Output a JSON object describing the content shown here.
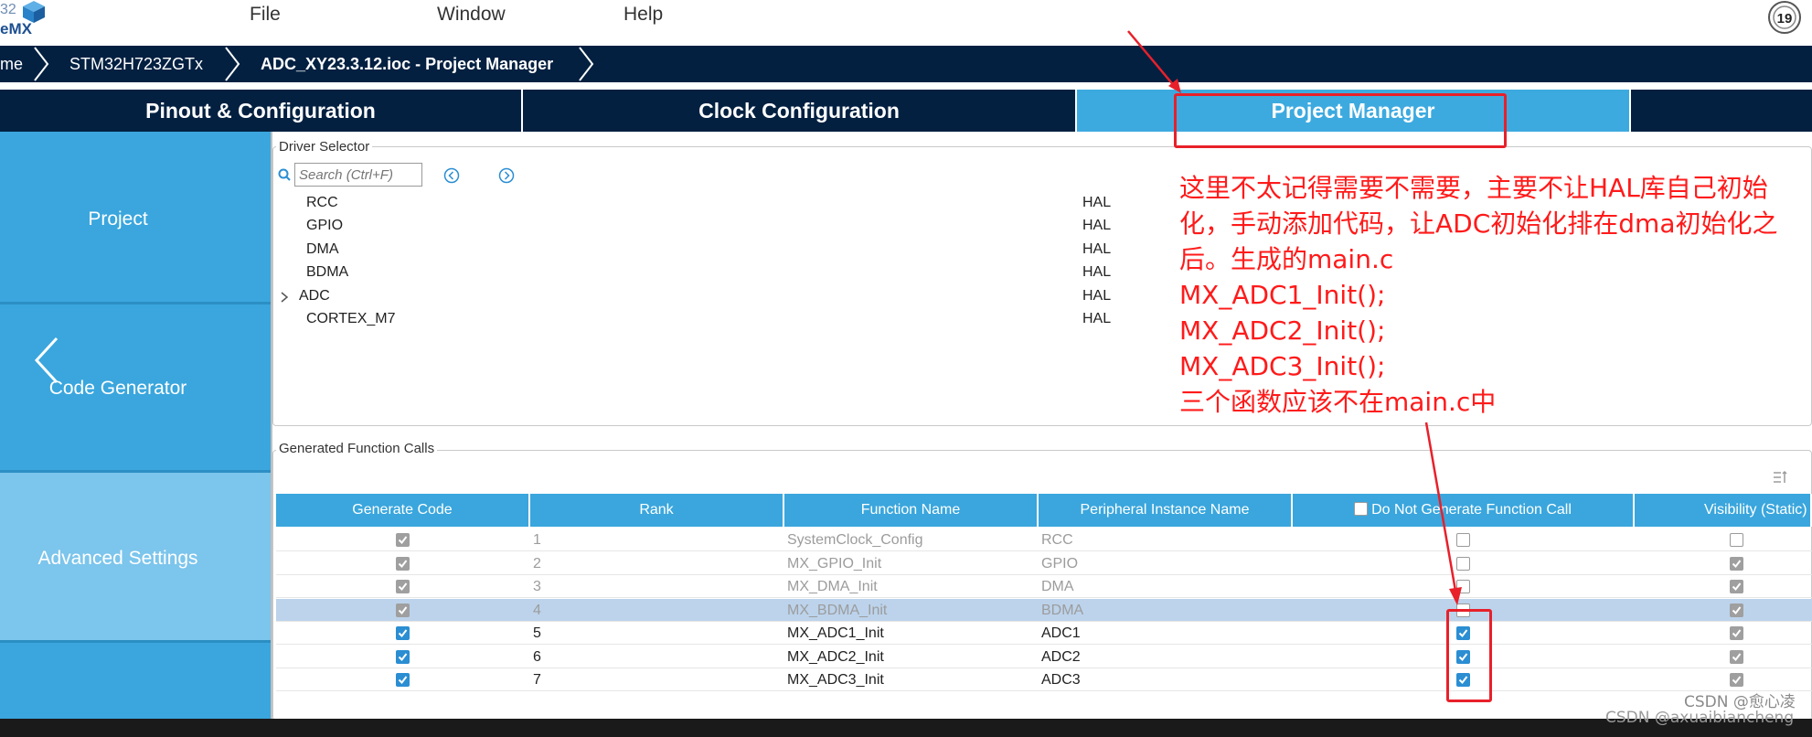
{
  "app": {
    "logo_line1": "32",
    "logo_line2": "eMX",
    "help_badge_number": "19"
  },
  "menu": {
    "file": "File",
    "window": "Window",
    "help": "Help"
  },
  "breadcrumb": {
    "home": "me",
    "device": "STM32H723ZGTx",
    "project": "ADC_XY23.3.12.ioc - Project Manager"
  },
  "tabs": {
    "pinout": "Pinout & Configuration",
    "clock": "Clock Configuration",
    "project_manager": "Project Manager"
  },
  "sidebar": {
    "project": "Project",
    "code_generator": "Code Generator",
    "advanced_settings": "Advanced Settings"
  },
  "driver_selector": {
    "title": "Driver Selector",
    "search_placeholder": "Search (Ctrl+F)",
    "rows": [
      {
        "name": "RCC",
        "driver": "HAL"
      },
      {
        "name": "GPIO",
        "driver": "HAL"
      },
      {
        "name": "DMA",
        "driver": "HAL"
      },
      {
        "name": "BDMA",
        "driver": "HAL"
      },
      {
        "name": "ADC",
        "driver": "HAL"
      },
      {
        "name": "CORTEX_M7",
        "driver": "HAL"
      }
    ]
  },
  "annotation": {
    "lines": [
      "这里不太记得需要不需要，主要不让HAL库自己初始",
      "化，手动添加代码，让ADC初始化排在dma初始化之",
      "后。生成的main.c",
      " MX_ADC1_Init();",
      " MX_ADC2_Init();",
      "MX_ADC3_Init();",
      "三个函数应该不在main.c中"
    ],
    "color": "#ff1a1a"
  },
  "function_calls": {
    "title": "Generated Function Calls",
    "headers": {
      "generate_code": "Generate Code",
      "rank": "Rank",
      "function_name": "Function Name",
      "peripheral": "Peripheral Instance Name",
      "do_not_generate": "Do Not Generate Function Call",
      "visibility": "Visibility (Static)"
    },
    "rows": [
      {
        "generate": true,
        "rank": "1",
        "function": "SystemClock_Config",
        "peripheral": "RCC",
        "do_not_generate": false,
        "visibility": false,
        "dim": true
      },
      {
        "generate": true,
        "rank": "2",
        "function": "MX_GPIO_Init",
        "peripheral": "GPIO",
        "do_not_generate": false,
        "visibility": true,
        "dim": true
      },
      {
        "generate": true,
        "rank": "3",
        "function": "MX_DMA_Init",
        "peripheral": "DMA",
        "do_not_generate": false,
        "visibility": true,
        "dim": true
      },
      {
        "generate": true,
        "rank": "4",
        "function": "MX_BDMA_Init",
        "peripheral": "BDMA",
        "do_not_generate": false,
        "visibility": true,
        "dim": true
      },
      {
        "generate": true,
        "rank": "5",
        "function": "MX_ADC1_Init",
        "peripheral": "ADC1",
        "do_not_generate": true,
        "visibility": true,
        "dim": false
      },
      {
        "generate": true,
        "rank": "6",
        "function": "MX_ADC2_Init",
        "peripheral": "ADC2",
        "do_not_generate": true,
        "visibility": true,
        "dim": false
      },
      {
        "generate": true,
        "rank": "7",
        "function": "MX_ADC3_Init",
        "peripheral": "ADC3",
        "do_not_generate": true,
        "visibility": true,
        "dim": false
      }
    ]
  },
  "watermark": {
    "line1": "CSDN @愈心凌",
    "line2": "CSDN @axuaibiancheng"
  },
  "colors": {
    "navy": "#032041",
    "accent_blue": "#3aa6dd",
    "highlight_red": "#e8202a"
  }
}
